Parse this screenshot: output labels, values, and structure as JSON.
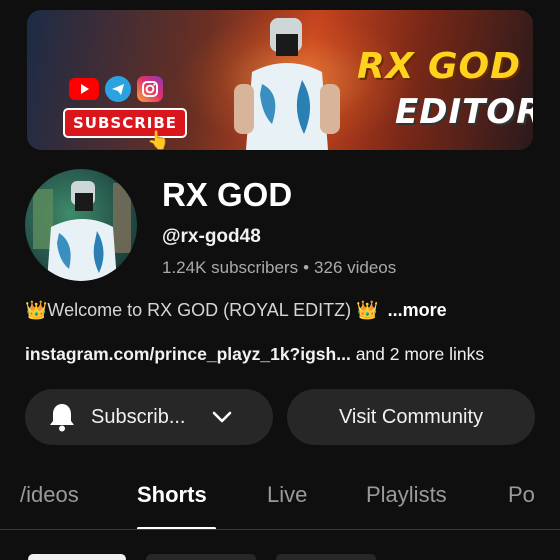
{
  "banner": {
    "title_line1": "RX GOD",
    "title_line2": "EDITOR",
    "subscribe_text": "SUBSCRIBE",
    "social_icons": [
      "youtube-icon",
      "telegram-icon",
      "instagram-icon"
    ]
  },
  "channel": {
    "name": "RX GOD",
    "handle": "@rx-god48",
    "subscribers": "1.24K subscribers",
    "separator": "•",
    "videos": "326 videos",
    "description_prefix": "👑",
    "description": "Welcome to RX GOD (ROYAL EDITZ)",
    "description_suffix": "👑",
    "more_label": "...more",
    "link_text": "instagram.com/prince_playz_1k?igsh...",
    "more_links": "and 2 more links"
  },
  "actions": {
    "subscribe_label": "Subscrib...",
    "community_label": "Visit Community"
  },
  "tabs": [
    {
      "label": "Videos",
      "visible_text": "/ideos",
      "active": false
    },
    {
      "label": "Shorts",
      "visible_text": "Shorts",
      "active": true
    },
    {
      "label": "Live",
      "visible_text": "Live",
      "active": false
    },
    {
      "label": "Playlists",
      "visible_text": "Playlists",
      "active": false
    },
    {
      "label": "Posts",
      "visible_text": "Po",
      "active": false
    }
  ],
  "colors": {
    "background": "#0f0f0f",
    "button_bg": "#272727",
    "banner_accent": "#ffd21e",
    "subscribe_red": "#d9161c"
  }
}
